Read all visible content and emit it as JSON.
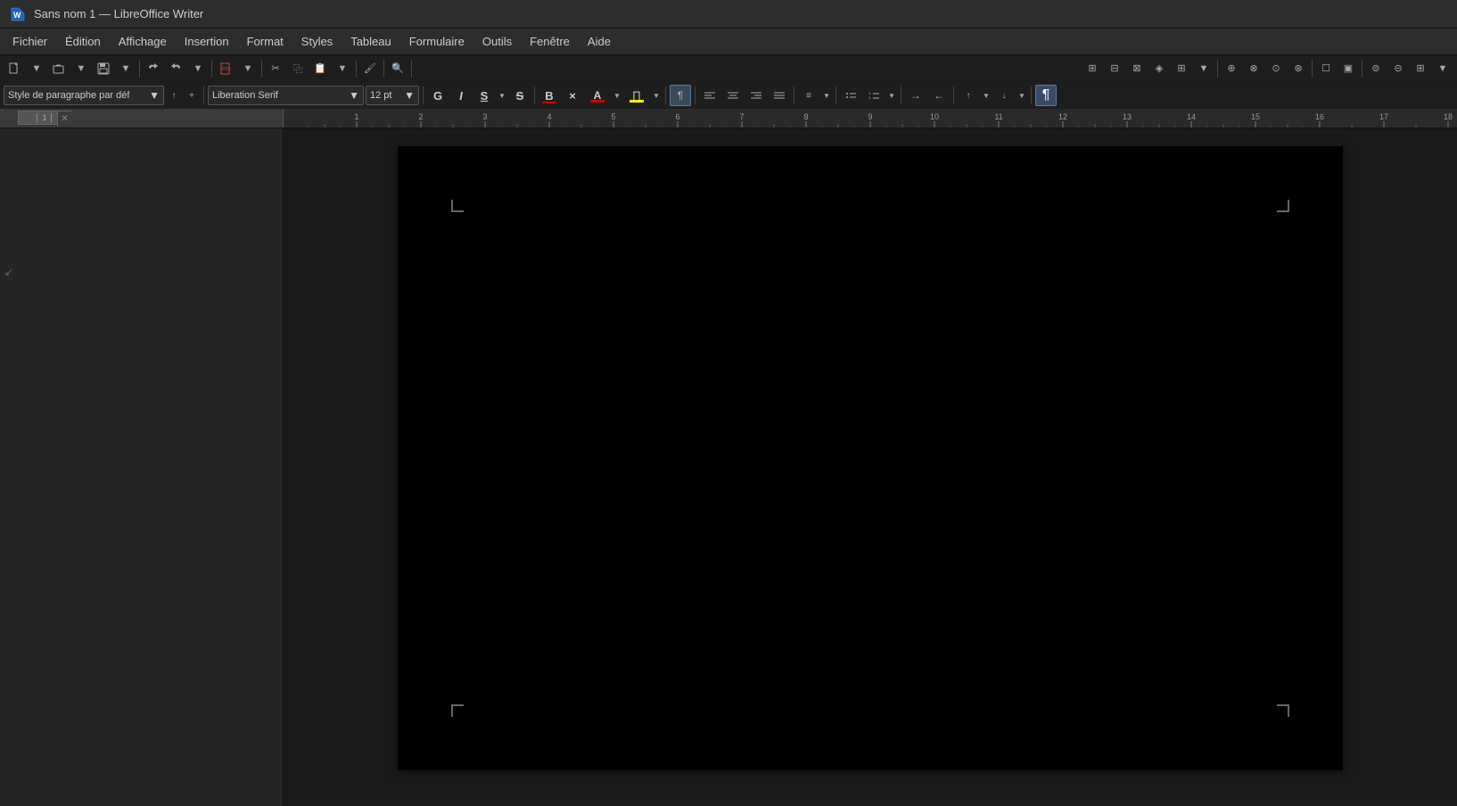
{
  "titlebar": {
    "title": "Sans nom 1 — LibreOffice Writer",
    "icon": "▶"
  },
  "menubar": {
    "items": [
      {
        "label": "Fichier",
        "id": "fichier"
      },
      {
        "label": "Édition",
        "id": "edition"
      },
      {
        "label": "Affichage",
        "id": "affichage"
      },
      {
        "label": "Insertion",
        "id": "insertion"
      },
      {
        "label": "Format",
        "id": "format"
      },
      {
        "label": "Styles",
        "id": "styles"
      },
      {
        "label": "Tableau",
        "id": "tableau"
      },
      {
        "label": "Formulaire",
        "id": "formulaire"
      },
      {
        "label": "Outils",
        "id": "outils"
      },
      {
        "label": "Fenêtre",
        "id": "fenetre"
      },
      {
        "label": "Aide",
        "id": "aide"
      }
    ]
  },
  "toolbar1": {
    "buttons": []
  },
  "formatting_toolbar": {
    "paragraph_style": {
      "value": "Style de paragraphe par déf",
      "placeholder": "Style de paragraphe par déf"
    },
    "font_name": {
      "value": "Liberation Serif"
    },
    "font_size": {
      "value": "12 pt"
    },
    "bold_label": "G",
    "italic_label": "I",
    "underline_label": "S",
    "strikethrough_label": "S",
    "shadow_label": "S"
  },
  "ruler": {
    "numbers": [
      "1",
      "2",
      "3",
      "4",
      "5",
      "6",
      "7",
      "8",
      "9",
      "10",
      "11",
      "12",
      "13",
      "14",
      "15",
      "16",
      "17",
      "18"
    ]
  },
  "document": {
    "background_color": "#000000"
  }
}
